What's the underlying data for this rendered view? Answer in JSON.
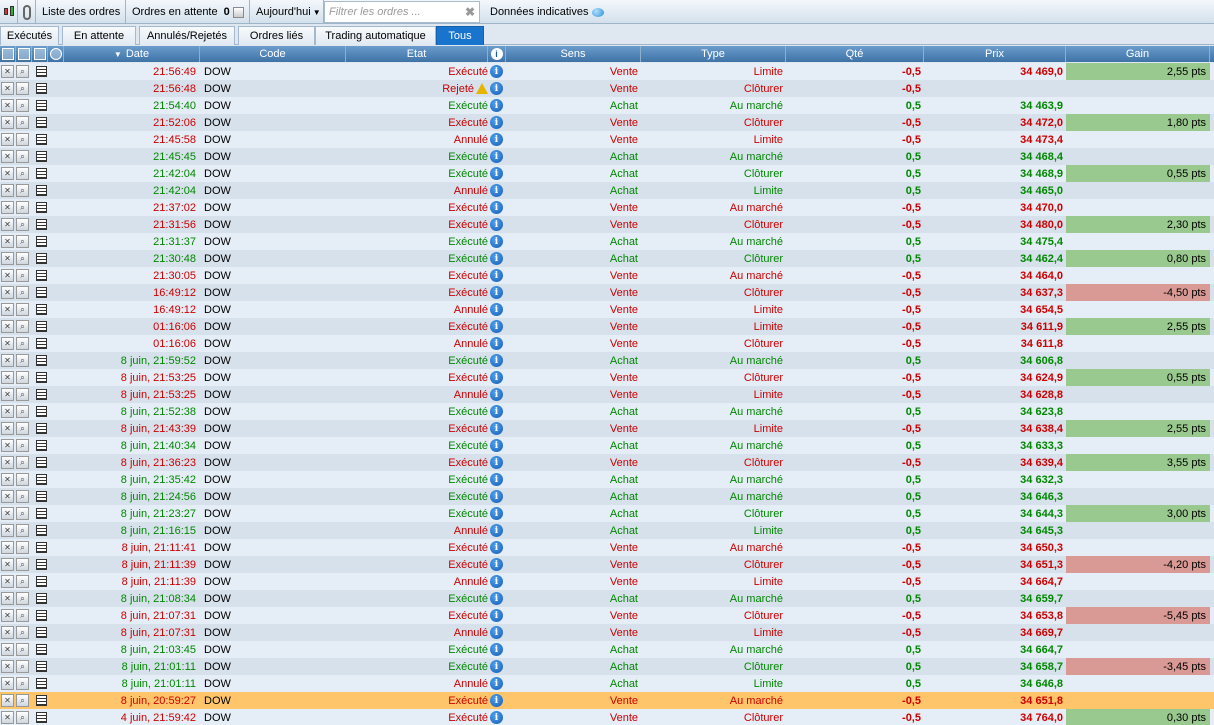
{
  "toolbar": {
    "orders_list_label": "Liste des ordres",
    "pending_label": "Ordres en attente",
    "pending_count": "0",
    "period_label": "Aujourd'hui",
    "filter_placeholder": "Filtrer les ordres ...",
    "indicative_label": "Données indicatives"
  },
  "tabs": [
    {
      "label": "Exécutés",
      "active": false
    },
    {
      "label": "En attente",
      "active": false
    },
    {
      "label": "Annulés/Rejetés",
      "active": false
    },
    {
      "label": "Ordres liés",
      "active": false
    },
    {
      "label": "Trading automatique",
      "active": false
    },
    {
      "label": "Tous",
      "active": true
    }
  ],
  "columns": {
    "date": "Date",
    "code": "Code",
    "etat": "Etat",
    "sens": "Sens",
    "type": "Type",
    "qte": "Qté",
    "prix": "Prix",
    "gain": "Gain"
  },
  "colors": {
    "red": "#cc0000",
    "green": "#008800",
    "gain_pos": "#99c98e",
    "gain_neg": "#d99995",
    "selected": "#ffc56b",
    "tab_active": "#1874cc"
  },
  "orders": [
    {
      "date": "21:56:49",
      "code": "DOW",
      "etat": "Exécuté",
      "sens": "Vente",
      "type": "Limite",
      "qte": "-0,5",
      "prix": "34 469,0",
      "gain": "2,55 pts"
    },
    {
      "date": "21:56:48",
      "code": "DOW",
      "etat": "Rejeté",
      "warn": true,
      "sens": "Vente",
      "type": "Clôturer",
      "qte": "-0,5",
      "prix": "",
      "gain": ""
    },
    {
      "date": "21:54:40",
      "code": "DOW",
      "etat": "Exécuté",
      "sens": "Achat",
      "type": "Au marché",
      "qte": "0,5",
      "prix": "34 463,9",
      "gain": ""
    },
    {
      "date": "21:52:06",
      "code": "DOW",
      "etat": "Exécuté",
      "sens": "Vente",
      "type": "Clôturer",
      "qte": "-0,5",
      "prix": "34 472,0",
      "gain": "1,80 pts"
    },
    {
      "date": "21:45:58",
      "code": "DOW",
      "etat": "Annulé",
      "sens": "Vente",
      "type": "Limite",
      "qte": "-0,5",
      "prix": "34 473,4",
      "gain": ""
    },
    {
      "date": "21:45:45",
      "code": "DOW",
      "etat": "Exécuté",
      "sens": "Achat",
      "type": "Au marché",
      "qte": "0,5",
      "prix": "34 468,4",
      "gain": ""
    },
    {
      "date": "21:42:04",
      "code": "DOW",
      "etat": "Exécuté",
      "sens": "Achat",
      "type": "Clôturer",
      "qte": "0,5",
      "prix": "34 468,9",
      "gain": "0,55 pts"
    },
    {
      "date": "21:42:04",
      "code": "DOW",
      "etat": "Annulé",
      "sens": "Achat",
      "type": "Limite",
      "qte": "0,5",
      "prix": "34 465,0",
      "gain": ""
    },
    {
      "date": "21:37:02",
      "code": "DOW",
      "etat": "Exécuté",
      "sens": "Vente",
      "type": "Au marché",
      "qte": "-0,5",
      "prix": "34 470,0",
      "gain": ""
    },
    {
      "date": "21:31:56",
      "code": "DOW",
      "etat": "Exécuté",
      "sens": "Vente",
      "type": "Clôturer",
      "qte": "-0,5",
      "prix": "34 480,0",
      "gain": "2,30 pts"
    },
    {
      "date": "21:31:37",
      "code": "DOW",
      "etat": "Exécuté",
      "sens": "Achat",
      "type": "Au marché",
      "qte": "0,5",
      "prix": "34 475,4",
      "gain": ""
    },
    {
      "date": "21:30:48",
      "code": "DOW",
      "etat": "Exécuté",
      "sens": "Achat",
      "type": "Clôturer",
      "qte": "0,5",
      "prix": "34 462,4",
      "gain": "0,80 pts"
    },
    {
      "date": "21:30:05",
      "code": "DOW",
      "etat": "Exécuté",
      "sens": "Vente",
      "type": "Au marché",
      "qte": "-0,5",
      "prix": "34 464,0",
      "gain": ""
    },
    {
      "date": "16:49:12",
      "code": "DOW",
      "etat": "Exécuté",
      "sens": "Vente",
      "type": "Clôturer",
      "qte": "-0,5",
      "prix": "34 637,3",
      "gain": "-4,50 pts"
    },
    {
      "date": "16:49:12",
      "code": "DOW",
      "etat": "Annulé",
      "sens": "Vente",
      "type": "Limite",
      "qte": "-0,5",
      "prix": "34 654,5",
      "gain": ""
    },
    {
      "date": "01:16:06",
      "code": "DOW",
      "etat": "Exécuté",
      "sens": "Vente",
      "type": "Limite",
      "qte": "-0,5",
      "prix": "34 611,9",
      "gain": "2,55 pts"
    },
    {
      "date": "01:16:06",
      "code": "DOW",
      "etat": "Annulé",
      "sens": "Vente",
      "type": "Clôturer",
      "qte": "-0,5",
      "prix": "34 611,8",
      "gain": ""
    },
    {
      "date": "8 juin, 21:59:52",
      "code": "DOW",
      "etat": "Exécuté",
      "sens": "Achat",
      "type": "Au marché",
      "qte": "0,5",
      "prix": "34 606,8",
      "gain": ""
    },
    {
      "date": "8 juin, 21:53:25",
      "code": "DOW",
      "etat": "Exécuté",
      "sens": "Vente",
      "type": "Clôturer",
      "qte": "-0,5",
      "prix": "34 624,9",
      "gain": "0,55 pts"
    },
    {
      "date": "8 juin, 21:53:25",
      "code": "DOW",
      "etat": "Annulé",
      "sens": "Vente",
      "type": "Limite",
      "qte": "-0,5",
      "prix": "34 628,8",
      "gain": ""
    },
    {
      "date": "8 juin, 21:52:38",
      "code": "DOW",
      "etat": "Exécuté",
      "sens": "Achat",
      "type": "Au marché",
      "qte": "0,5",
      "prix": "34 623,8",
      "gain": ""
    },
    {
      "date": "8 juin, 21:43:39",
      "code": "DOW",
      "etat": "Exécuté",
      "sens": "Vente",
      "type": "Limite",
      "qte": "-0,5",
      "prix": "34 638,4",
      "gain": "2,55 pts"
    },
    {
      "date": "8 juin, 21:40:34",
      "code": "DOW",
      "etat": "Exécuté",
      "sens": "Achat",
      "type": "Au marché",
      "qte": "0,5",
      "prix": "34 633,3",
      "gain": ""
    },
    {
      "date": "8 juin, 21:36:23",
      "code": "DOW",
      "etat": "Exécuté",
      "sens": "Vente",
      "type": "Clôturer",
      "qte": "-0,5",
      "prix": "34 639,4",
      "gain": "3,55 pts"
    },
    {
      "date": "8 juin, 21:35:42",
      "code": "DOW",
      "etat": "Exécuté",
      "sens": "Achat",
      "type": "Au marché",
      "qte": "0,5",
      "prix": "34 632,3",
      "gain": ""
    },
    {
      "date": "8 juin, 21:24:56",
      "code": "DOW",
      "etat": "Exécuté",
      "sens": "Achat",
      "type": "Au marché",
      "qte": "0,5",
      "prix": "34 646,3",
      "gain": ""
    },
    {
      "date": "8 juin, 21:23:27",
      "code": "DOW",
      "etat": "Exécuté",
      "sens": "Achat",
      "type": "Clôturer",
      "qte": "0,5",
      "prix": "34 644,3",
      "gain": "3,00 pts"
    },
    {
      "date": "8 juin, 21:16:15",
      "code": "DOW",
      "etat": "Annulé",
      "sens": "Achat",
      "type": "Limite",
      "qte": "0,5",
      "prix": "34 645,3",
      "gain": ""
    },
    {
      "date": "8 juin, 21:11:41",
      "code": "DOW",
      "etat": "Exécuté",
      "sens": "Vente",
      "type": "Au marché",
      "qte": "-0,5",
      "prix": "34 650,3",
      "gain": ""
    },
    {
      "date": "8 juin, 21:11:39",
      "code": "DOW",
      "etat": "Exécuté",
      "sens": "Vente",
      "type": "Clôturer",
      "qte": "-0,5",
      "prix": "34 651,3",
      "gain": "-4,20 pts"
    },
    {
      "date": "8 juin, 21:11:39",
      "code": "DOW",
      "etat": "Annulé",
      "sens": "Vente",
      "type": "Limite",
      "qte": "-0,5",
      "prix": "34 664,7",
      "gain": ""
    },
    {
      "date": "8 juin, 21:08:34",
      "code": "DOW",
      "etat": "Exécuté",
      "sens": "Achat",
      "type": "Au marché",
      "qte": "0,5",
      "prix": "34 659,7",
      "gain": ""
    },
    {
      "date": "8 juin, 21:07:31",
      "code": "DOW",
      "etat": "Exécuté",
      "sens": "Vente",
      "type": "Clôturer",
      "qte": "-0,5",
      "prix": "34 653,8",
      "gain": "-5,45 pts"
    },
    {
      "date": "8 juin, 21:07:31",
      "code": "DOW",
      "etat": "Annulé",
      "sens": "Vente",
      "type": "Limite",
      "qte": "-0,5",
      "prix": "34 669,7",
      "gain": ""
    },
    {
      "date": "8 juin, 21:03:45",
      "code": "DOW",
      "etat": "Exécuté",
      "sens": "Achat",
      "type": "Au marché",
      "qte": "0,5",
      "prix": "34 664,7",
      "gain": ""
    },
    {
      "date": "8 juin, 21:01:11",
      "code": "DOW",
      "etat": "Exécuté",
      "sens": "Achat",
      "type": "Clôturer",
      "qte": "0,5",
      "prix": "34 658,7",
      "gain": "-3,45 pts"
    },
    {
      "date": "8 juin, 21:01:11",
      "code": "DOW",
      "etat": "Annulé",
      "sens": "Achat",
      "type": "Limite",
      "qte": "0,5",
      "prix": "34 646,8",
      "gain": ""
    },
    {
      "date": "8 juin, 20:59:27",
      "code": "DOW",
      "etat": "Exécuté",
      "sens": "Vente",
      "type": "Au marché",
      "qte": "-0,5",
      "prix": "34 651,8",
      "gain": "",
      "selected": true
    },
    {
      "date": "4 juin, 21:59:42",
      "code": "DOW",
      "etat": "Exécuté",
      "sens": "Vente",
      "type": "Clôturer",
      "qte": "-0,5",
      "prix": "34 764,0",
      "gain": "0,30 pts"
    }
  ]
}
